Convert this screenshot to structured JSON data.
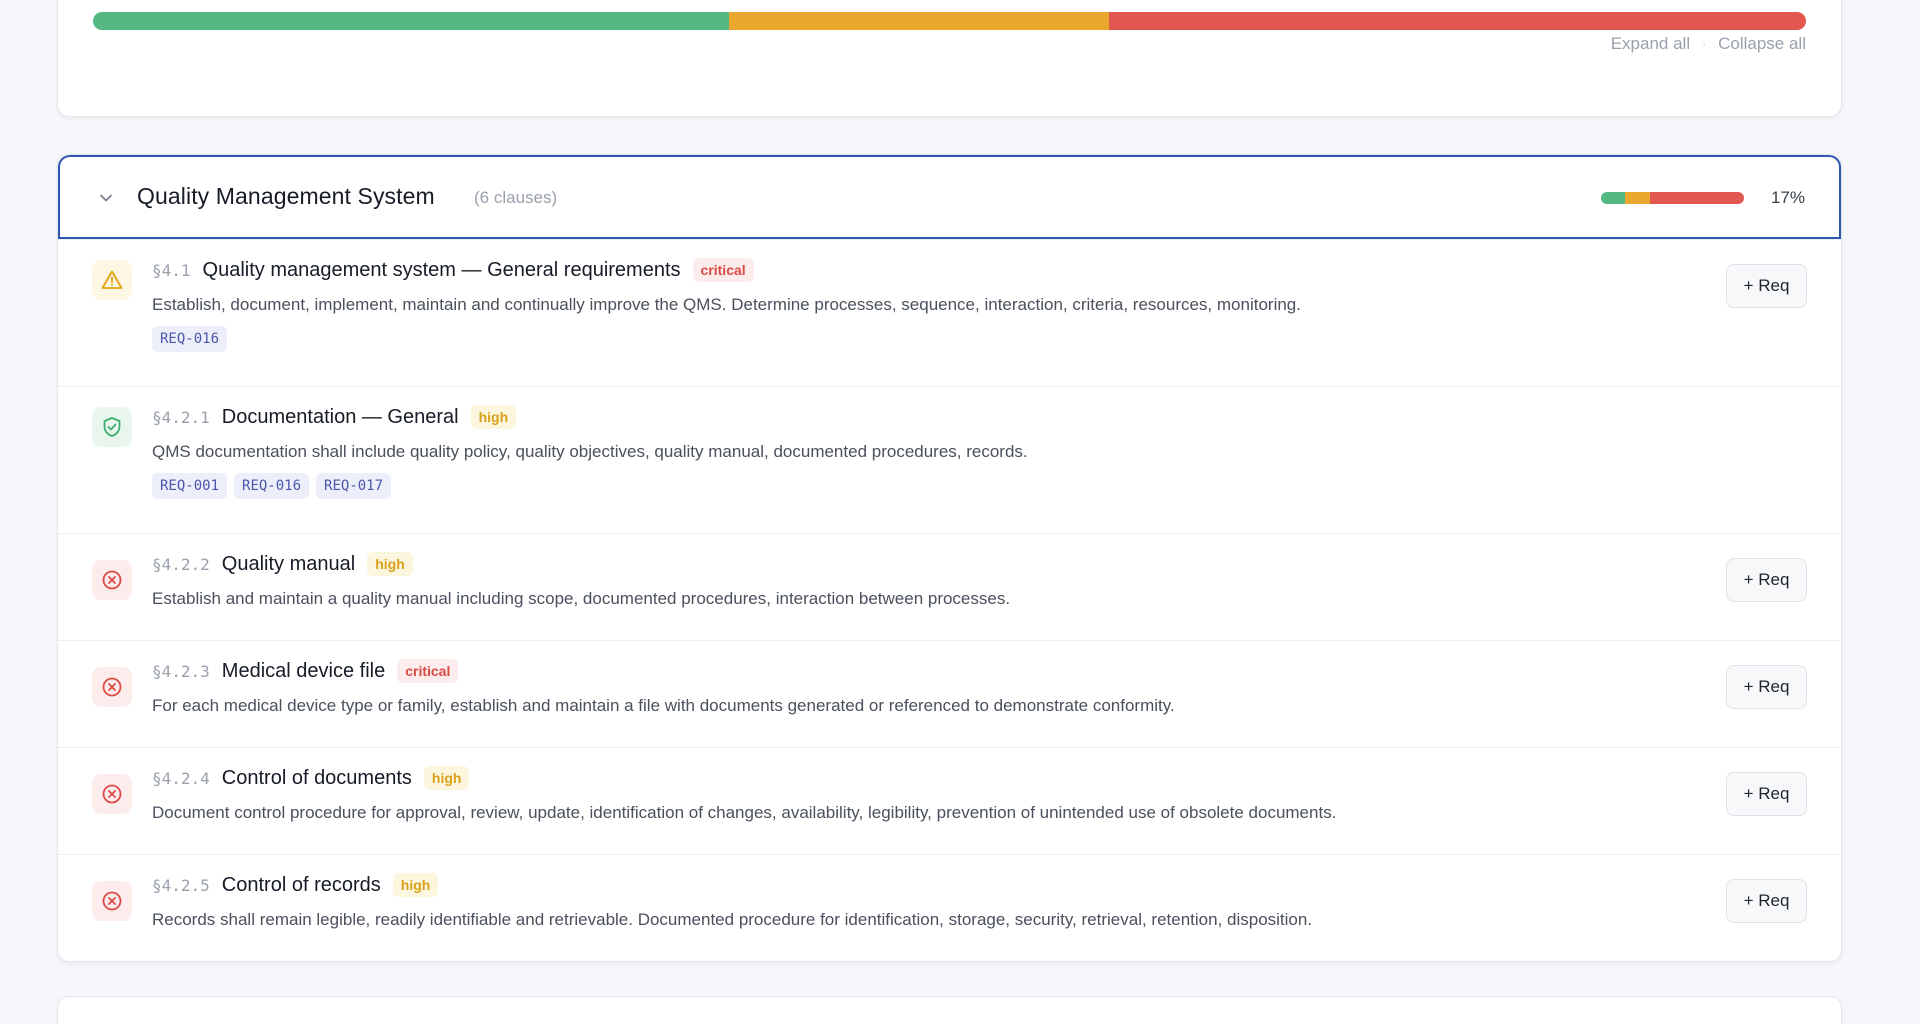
{
  "summary": {
    "progress_segments": [
      {
        "status": "compliant",
        "fraction": 0.371,
        "color": "#55b882"
      },
      {
        "status": "partial",
        "fraction": 0.222,
        "color": "#eaa72e"
      },
      {
        "status": "gap",
        "fraction": 0.407,
        "color": "#e2574f"
      }
    ],
    "expand_all": "Expand all",
    "separator": "·",
    "collapse_all": "Collapse all"
  },
  "section": {
    "title": "Quality Management System",
    "count_label": "(6 clauses)",
    "percent": "17%",
    "progress_segments": [
      {
        "status": "compliant",
        "fraction": 0.17,
        "color": "#55b882"
      },
      {
        "status": "partial",
        "fraction": 0.17,
        "color": "#eaa72e"
      },
      {
        "status": "gap",
        "fraction": 0.66,
        "color": "#e2574f"
      }
    ],
    "clauses": [
      {
        "status": "warning",
        "number": "§4.1",
        "title": "Quality management system — General requirements",
        "severity": "critical",
        "description": "Establish, document, implement, maintain and continually improve the QMS. Determine processes, sequence, interaction, criteria, resources, monitoring.",
        "reqs": [
          "REQ-016"
        ],
        "button": "+ Req"
      },
      {
        "status": "compliant",
        "number": "§4.2.1",
        "title": "Documentation — General",
        "severity": "high",
        "description": "QMS documentation shall include quality policy, quality objectives, quality manual, documented procedures, records.",
        "reqs": [
          "REQ-001",
          "REQ-016",
          "REQ-017"
        ]
      },
      {
        "status": "gap",
        "number": "§4.2.2",
        "title": "Quality manual",
        "severity": "high",
        "description": "Establish and maintain a quality manual including scope, documented procedures, interaction between processes.",
        "button": "+ Req"
      },
      {
        "status": "gap",
        "number": "§4.2.3",
        "title": "Medical device file",
        "severity": "critical",
        "description": "For each medical device type or family, establish and maintain a file with documents generated or referenced to demonstrate conformity.",
        "button": "+ Req"
      },
      {
        "status": "gap",
        "number": "§4.2.4",
        "title": "Control of documents",
        "severity": "high",
        "description": "Document control procedure for approval, review, update, identification of changes, availability, legibility, prevention of unintended use of obsolete documents.",
        "button": "+ Req"
      },
      {
        "status": "gap",
        "number": "§4.2.5",
        "title": "Control of records",
        "severity": "high",
        "description": "Records shall remain legible, readily identifiable and retrievable. Documented procedure for identification, storage, security, retrieval, retention, disposition.",
        "button": "+ Req"
      }
    ]
  }
}
